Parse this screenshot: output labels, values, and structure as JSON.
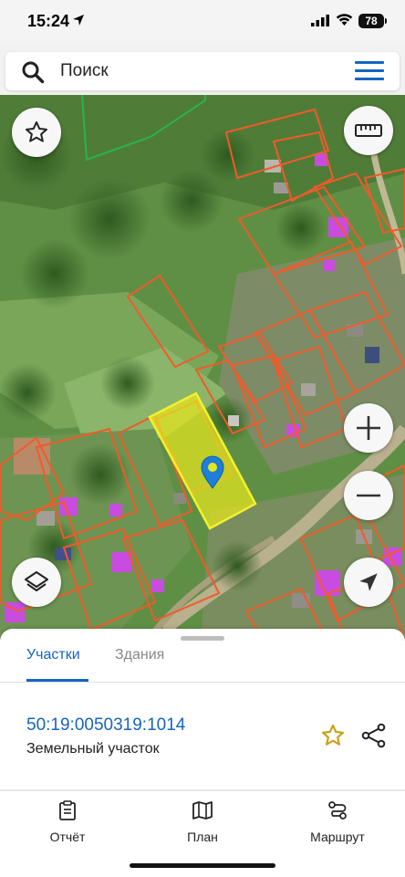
{
  "status_bar": {
    "time": "15:24",
    "battery": "78"
  },
  "search": {
    "placeholder": "Поиск"
  },
  "sheet": {
    "tabs": [
      {
        "label": "Участки",
        "active": true
      },
      {
        "label": "Здания",
        "active": false
      }
    ],
    "parcel": {
      "cadastral_number": "50:19:0050319:1014",
      "type": "Земельный участок",
      "favorite_color": "#c9a21b"
    }
  },
  "bottom_nav": [
    {
      "label": "Отчёт",
      "icon": "report-icon"
    },
    {
      "label": "План",
      "icon": "map-book-icon"
    },
    {
      "label": "Маршрут",
      "icon": "route-icon"
    }
  ],
  "colors": {
    "accent": "#1565c0",
    "parcel_border": "#f15a2a",
    "selected_parcel": "#e6e61e",
    "building_marker": "#c84ce0"
  }
}
